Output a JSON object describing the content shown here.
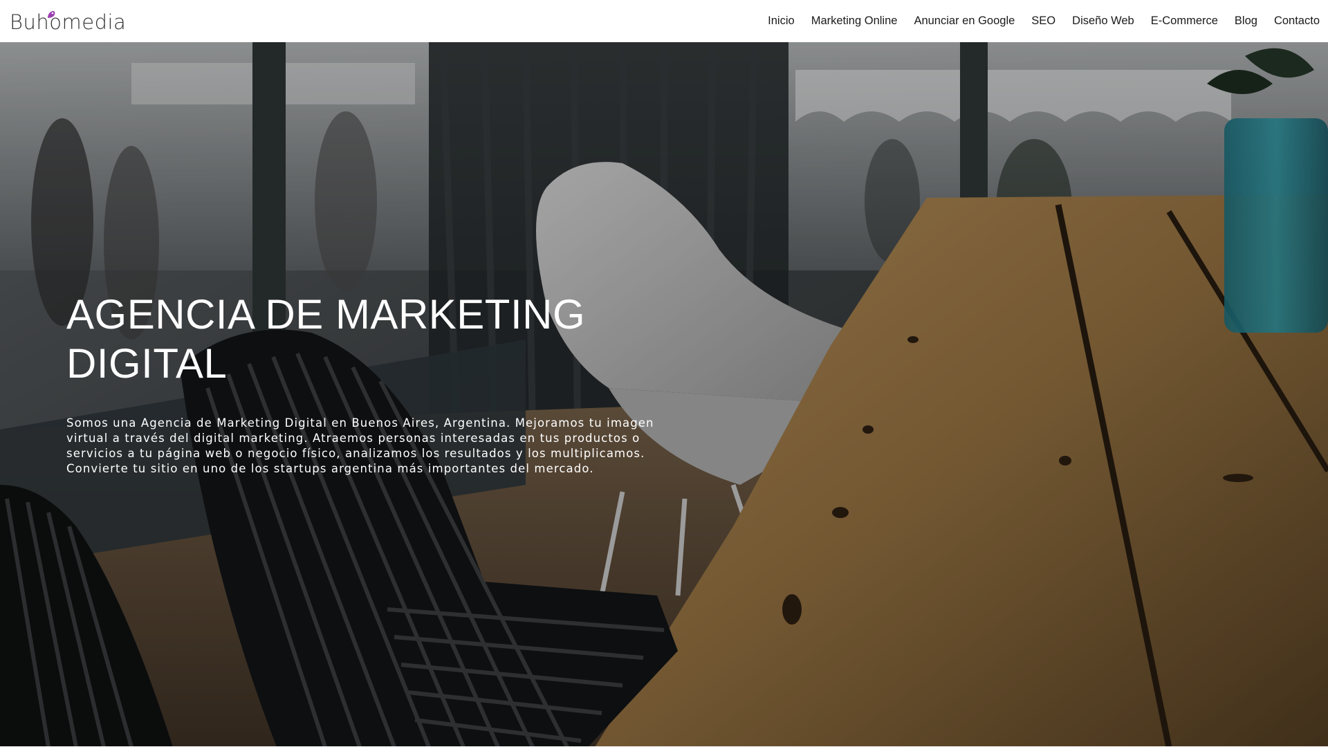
{
  "brand": {
    "name": "Buhomedia",
    "accent": "#9b3fb0"
  },
  "nav": {
    "items": [
      {
        "label": "Inicio"
      },
      {
        "label": "Marketing Online"
      },
      {
        "label": "Anunciar en Google"
      },
      {
        "label": "SEO"
      },
      {
        "label": "Diseño Web"
      },
      {
        "label": "E-Commerce"
      },
      {
        "label": "Blog"
      },
      {
        "label": "Contacto"
      }
    ]
  },
  "hero": {
    "title": "AGENCIA DE MARKETING DIGITAL",
    "text": "Somos una Agencia de Marketing Digital en Buenos Aires, Argentina. Mejoramos tu imagen virtual a través del digital marketing. Atraemos personas interesadas en tus productos o servicios a tu página web o negocio físico, analizamos los resultados y los multiplicamos. Convierte tu sitio en uno de los startups argentina más importantes del mercado."
  }
}
